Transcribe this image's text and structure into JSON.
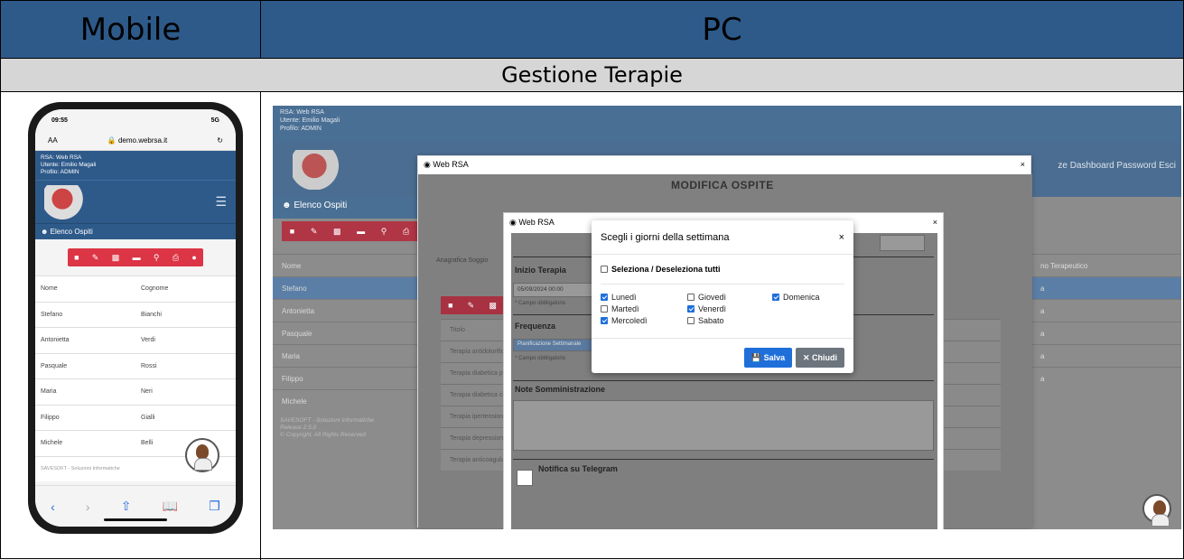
{
  "header": {
    "mobile": "Mobile",
    "pc": "PC"
  },
  "subheader": "Gestione Terapie",
  "mobile": {
    "time": "09:55",
    "signal": "5G",
    "aa": "AA",
    "url": "demo.webrsa.it",
    "info": [
      "RSA: Web RSA",
      "Utente: Emilio Magali",
      "Profilo: ADMIN"
    ],
    "section": "Elenco Ospiti",
    "columns": [
      "Nome",
      "Cognome"
    ],
    "rows": [
      [
        "Stefano",
        "Bianchi"
      ],
      [
        "Antonietta",
        "Verdi"
      ],
      [
        "Pasquale",
        "Rossi"
      ],
      [
        "Maria",
        "Neri"
      ],
      [
        "Filippo",
        "Gialli"
      ],
      [
        "Michele",
        "Belli"
      ]
    ],
    "footer": "SAVESOFT - Soluzioni Informatiche"
  },
  "pc": {
    "info": [
      "RSA: Web RSA",
      "Utente: Emilio Magali",
      "Profilo: ADMIN"
    ],
    "nav": "ze  Dashboard  Password  Esci",
    "section": "Elenco Ospiti",
    "names": [
      "Nome",
      "Stefano",
      "Antonietta",
      "Pasquale",
      "Maria",
      "Filippo",
      "Michele"
    ],
    "right_col": [
      "no Terapeutico",
      "a",
      "a",
      "a",
      "a",
      "a"
    ],
    "footer": [
      "SAVESOFT - Soluzioni Informatiche",
      "Release 2.5.0",
      "© Copyright. All Rights Reserved"
    ],
    "dialog1": {
      "title": "Web RSA",
      "heading": "MODIFICA OSPITE",
      "tabs": "Anagrafica    Soggio",
      "table": [
        "Titolo",
        "Terapia antidolorifica",
        "Terapia diabetica pr",
        "Terapia diabetica co",
        "Terapia ipertensione",
        "Terapia depressione",
        "Terapia anticoagulante"
      ]
    },
    "dialog2": {
      "title": "Web RSA",
      "inizio_label": "Inizio Terapia",
      "inizio_value": "05/09/2024 00:00",
      "campo1": "* Campo obbligatorio",
      "frequenza_label": "Frequenza",
      "frequenza_value": "Pianificazione Settimanale",
      "campo2": "* Campo obbligatorio",
      "note_label": "Note Somministrazione",
      "telegram_label": "Notifica su Telegram"
    },
    "modal": {
      "title": "Scegli i giorni della settimana",
      "close": "×",
      "select_all": "Seleziona / Deseleziona tutti",
      "days": [
        {
          "label": "Lunedì",
          "checked": true
        },
        {
          "label": "Martedì",
          "checked": false
        },
        {
          "label": "Mercoledì",
          "checked": true
        },
        {
          "label": "Giovedì",
          "checked": false
        },
        {
          "label": "Venerdì",
          "checked": true
        },
        {
          "label": "Sabato",
          "checked": false
        },
        {
          "label": "Domenica",
          "checked": true
        }
      ],
      "save": "Salva",
      "cancel": "Chiudi"
    }
  }
}
